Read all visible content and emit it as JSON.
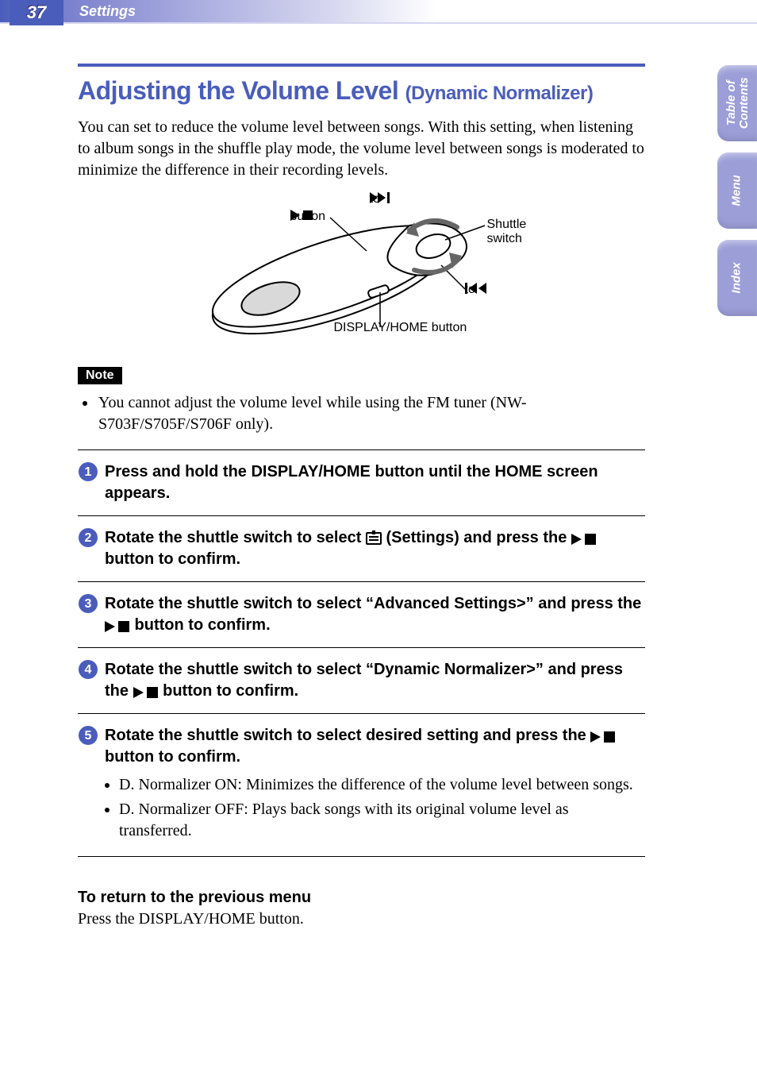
{
  "header": {
    "page_number": "37",
    "section": "Settings"
  },
  "side_tabs": {
    "toc": "Table of\nContents",
    "menu": "Menu",
    "index": "Index"
  },
  "title": {
    "main": "Adjusting the Volume Level ",
    "sub": "(Dynamic Normalizer)"
  },
  "intro": "You can set to reduce the volume level between songs. With this setting, when listening to album songs in the shuffle play mode, the volume level between songs is moderated to minimize the difference in their recording levels.",
  "figure": {
    "to_next": "to ",
    "to_prev": "to ",
    "playstop_button": " button",
    "shuttle": "Shuttle switch",
    "display_home": "DISPLAY/HOME button"
  },
  "note": {
    "label": "Note",
    "items": [
      "You cannot adjust the volume level while using the FM tuner (NW-S703F/S705F/S706F only)."
    ]
  },
  "steps": [
    {
      "n": "1",
      "text_before": "Press and hold the DISPLAY/HOME button until the HOME screen appears.",
      "icons": [],
      "text_after": "",
      "sub": []
    },
    {
      "n": "2",
      "text_before": "Rotate the shuttle switch to select ",
      "icons": [
        "settings"
      ],
      "text_mid": " (Settings) and press the ",
      "icons2": [
        "playstop"
      ],
      "text_after": " button to confirm.",
      "sub": []
    },
    {
      "n": "3",
      "text_before": "Rotate the shuttle switch to select “Advanced Settings>” and press the ",
      "icons": [
        "playstop"
      ],
      "text_after": " button to confirm.",
      "sub": []
    },
    {
      "n": "4",
      "text_before": "Rotate the shuttle switch to select “Dynamic Normalizer>” and press the ",
      "icons": [
        "playstop"
      ],
      "text_after": " button to confirm.",
      "sub": []
    },
    {
      "n": "5",
      "text_before": "Rotate the shuttle switch to select desired setting and press the ",
      "icons": [
        "playstop"
      ],
      "text_after": " button to confirm.",
      "sub": [
        "D. Normalizer ON: Minimizes the difference of the volume level between songs.",
        "D. Normalizer OFF: Plays back songs with its original volume level as transferred."
      ]
    }
  ],
  "return": {
    "heading": "To return to the previous menu",
    "body": "Press the DISPLAY/HOME button."
  }
}
